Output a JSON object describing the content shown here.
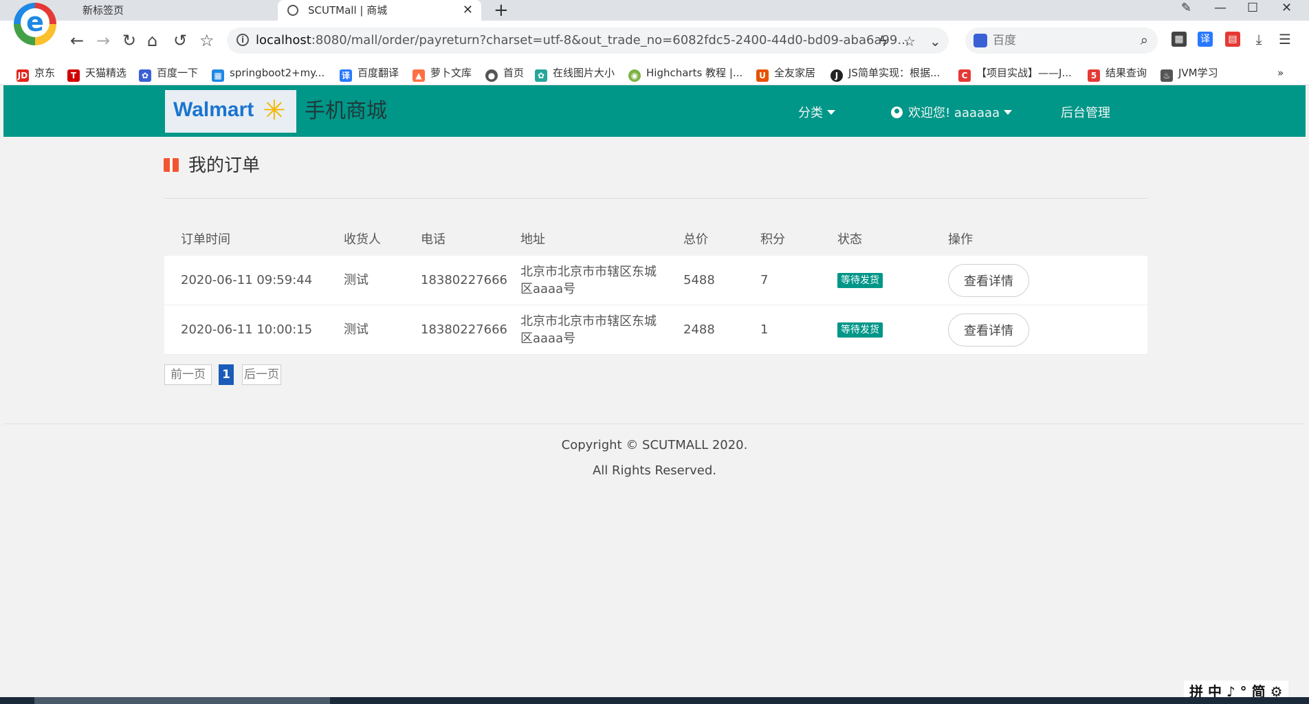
{
  "browser": {
    "tabs": [
      {
        "label": "新标签页"
      },
      {
        "label": "SCUTMall | 商城"
      }
    ],
    "new_tab": "+",
    "url_host": "localhost",
    "url_rest": ":8080/mall/order/payreturn?charset=utf-8&out_trade_no=6082fdc5-2400-44d0-bd09-aba6a99...",
    "search_placeholder": "百度",
    "bookmarks": [
      {
        "label": "京东",
        "color": "#e1251b",
        "glyph": "JD"
      },
      {
        "label": "天猫精选",
        "color": "#d00000",
        "glyph": "T"
      },
      {
        "label": "百度一下",
        "color": "#3a60d6",
        "glyph": "✿"
      },
      {
        "label": "springboot2+my...",
        "color": "#1e88e5",
        "glyph": "▦"
      },
      {
        "label": "百度翻译",
        "color": "#2979ff",
        "glyph": "译"
      },
      {
        "label": "萝卜文库",
        "color": "#ff7043",
        "glyph": "▲"
      },
      {
        "label": "首页",
        "color": "#555555",
        "glyph": "●"
      },
      {
        "label": "在线图片大小",
        "color": "#26a69a",
        "glyph": "✿"
      },
      {
        "label": "Highcharts 教程 |...",
        "color": "#7cb342",
        "glyph": "◉"
      },
      {
        "label": "全友家居",
        "color": "#e65100",
        "glyph": "U"
      },
      {
        "label": "JS简单实现：根据...",
        "color": "#222222",
        "glyph": "J"
      },
      {
        "label": "【项目实战】——J...",
        "color": "#e53935",
        "glyph": "C"
      },
      {
        "label": "结果查询",
        "color": "#e53935",
        "glyph": "5"
      },
      {
        "label": "JVM学习",
        "color": "#555555",
        "glyph": "♨"
      }
    ],
    "more": "»"
  },
  "navbar": {
    "brand_logo": "Walmart",
    "brand_title": "手机商城",
    "category": "分类",
    "welcome": "欢迎您! aaaaaa",
    "admin": "后台管理"
  },
  "page": {
    "heading": "我的订单"
  },
  "orders": {
    "headers": [
      "订单时间",
      "收货人",
      "电话",
      "地址",
      "总价",
      "积分",
      "状态",
      "操作"
    ],
    "rows": [
      {
        "time": "2020-06-11 09:59:44",
        "receiver": "测试",
        "phone": "18380227666",
        "address": "北京市北京市市辖区东城区aaaa号",
        "total": "5488",
        "points": "7",
        "status": "等待发货",
        "action": "查看详情"
      },
      {
        "time": "2020-06-11 10:00:15",
        "receiver": "测试",
        "phone": "18380227666",
        "address": "北京市北京市市辖区东城区aaaa号",
        "total": "2488",
        "points": "1",
        "status": "等待发货",
        "action": "查看详情"
      }
    ]
  },
  "pager": {
    "prev": "前一页",
    "current": "1",
    "next": "后一页"
  },
  "footer": {
    "line1": "Copyright © SCUTMALL 2020.",
    "line2": "All Rights Reserved."
  },
  "ime": "拼 中 ♪ ° 简 ⚙",
  "colors": {
    "navbar": "#009688",
    "badge": "#009688",
    "pager_current": "#1b5bb8",
    "gift_icon": "#f25630"
  }
}
